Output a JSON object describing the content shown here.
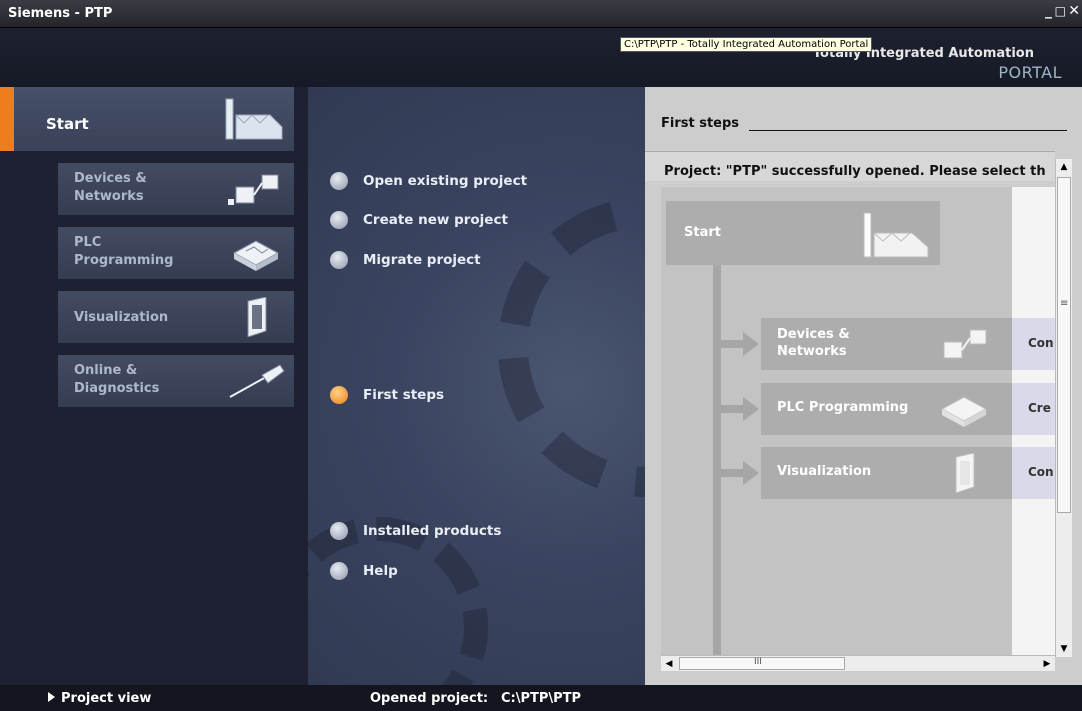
{
  "window": {
    "title": "Siemens  -  PTP",
    "minimize": "_",
    "maximize": "□",
    "close": "✕"
  },
  "header": {
    "brand_line1": "Totally Integrated Automation",
    "brand_line2": "PORTAL",
    "tooltip": "C:\\PTP\\PTP - Totally Integrated Automation Portal"
  },
  "leftnav": {
    "start_label": "Start",
    "items": [
      {
        "label_line1": "Devices &",
        "label_line2": "Networks",
        "icon": "devices-networks-icon"
      },
      {
        "label_line1": "PLC",
        "label_line2": "Programming",
        "icon": "plc-programming-icon"
      },
      {
        "label_line1": "Visualization",
        "label_line2": "",
        "icon": "visualization-icon"
      },
      {
        "label_line1": "Online &",
        "label_line2": "Diagnostics",
        "icon": "online-diagnostics-icon"
      }
    ]
  },
  "middle": {
    "items": [
      {
        "label": "Open existing project"
      },
      {
        "label": "Create new project"
      },
      {
        "label": "Migrate project"
      },
      {
        "label": "First steps",
        "active": true
      },
      {
        "label": "Installed products"
      },
      {
        "label": "Help"
      }
    ]
  },
  "content": {
    "title": "First steps",
    "message": "Project: \"PTP\" successfully opened. Please select th",
    "flow_start": "Start",
    "flow_items": [
      {
        "label_line1": "Devices &",
        "label_line2": "Networks",
        "ext": "Con"
      },
      {
        "label_line1": "PLC Programming",
        "label_line2": "",
        "ext": "Cre"
      },
      {
        "label_line1": "Visualization",
        "label_line2": "",
        "ext": "Con"
      }
    ],
    "vscroll_grip": "≡",
    "hscroll_grip": "III"
  },
  "status": {
    "project_view": "Project view",
    "opened_label": "Opened project:",
    "opened_value": "C:\\PTP\\PTP"
  },
  "colors": {
    "accent": "#ee7d1b",
    "nav_bg": "#1d2131",
    "content_bg": "#cdcdcd"
  }
}
